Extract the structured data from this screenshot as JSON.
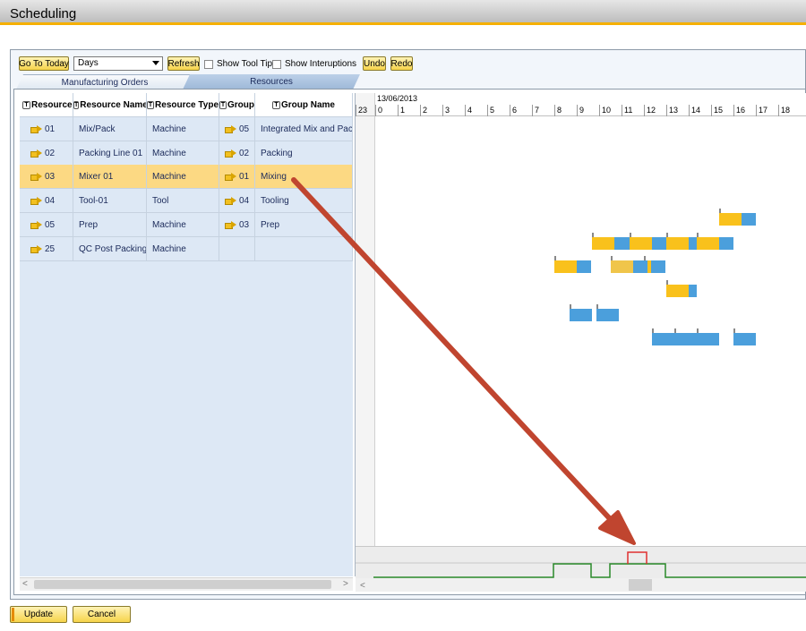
{
  "window": {
    "title": "Scheduling"
  },
  "toolbar": {
    "go_today": "Go To Today",
    "view_select": "Days",
    "refresh": "Refresh",
    "show_tooltip": "Show Tool Tip",
    "show_interruptions": "Show Interuptions",
    "undo": "Undo",
    "redo": "Redo"
  },
  "tabs": [
    {
      "label": "Manufacturing Orders"
    },
    {
      "label": "Resources"
    }
  ],
  "grid": {
    "columns": [
      "Resource",
      "Resource Name",
      "Resource Type",
      "Group",
      "Group Name"
    ],
    "rows": [
      {
        "resource": "01",
        "name": "Mix/Pack",
        "type": "Machine",
        "group": "05",
        "group_name": "Integrated Mix and Pack"
      },
      {
        "resource": "02",
        "name": "Packing Line 01",
        "type": "Machine",
        "group": "02",
        "group_name": "Packing"
      },
      {
        "resource": "03",
        "name": "Mixer 01",
        "type": "Machine",
        "group": "01",
        "group_name": "Mixing"
      },
      {
        "resource": "04",
        "name": "Tool-01",
        "type": "Tool",
        "group": "04",
        "group_name": "Tooling"
      },
      {
        "resource": "05",
        "name": "Prep",
        "type": "Machine",
        "group": "03",
        "group_name": "Prep"
      },
      {
        "resource": "25",
        "name": "QC Post Packing",
        "type": "Machine",
        "group": "",
        "group_name": ""
      }
    ]
  },
  "gantt": {
    "date": "13/06/2013",
    "hours": [
      "23",
      "0",
      "1",
      "2",
      "3",
      "4",
      "5",
      "6",
      "7",
      "8",
      "9",
      "10",
      "11",
      "12",
      "13",
      "14",
      "15",
      "16",
      "17",
      "18"
    ]
  },
  "footer": {
    "update": "Update",
    "cancel": "Cancel"
  },
  "colors": {
    "accent": "#f5b000",
    "bar_yellow": "#f9c11c",
    "bar_blue": "#4b9fdc",
    "selected_row": "#fcd983",
    "arrow": "#c0452f",
    "load_line": "#2a8a2a",
    "overload": "#e03030"
  }
}
